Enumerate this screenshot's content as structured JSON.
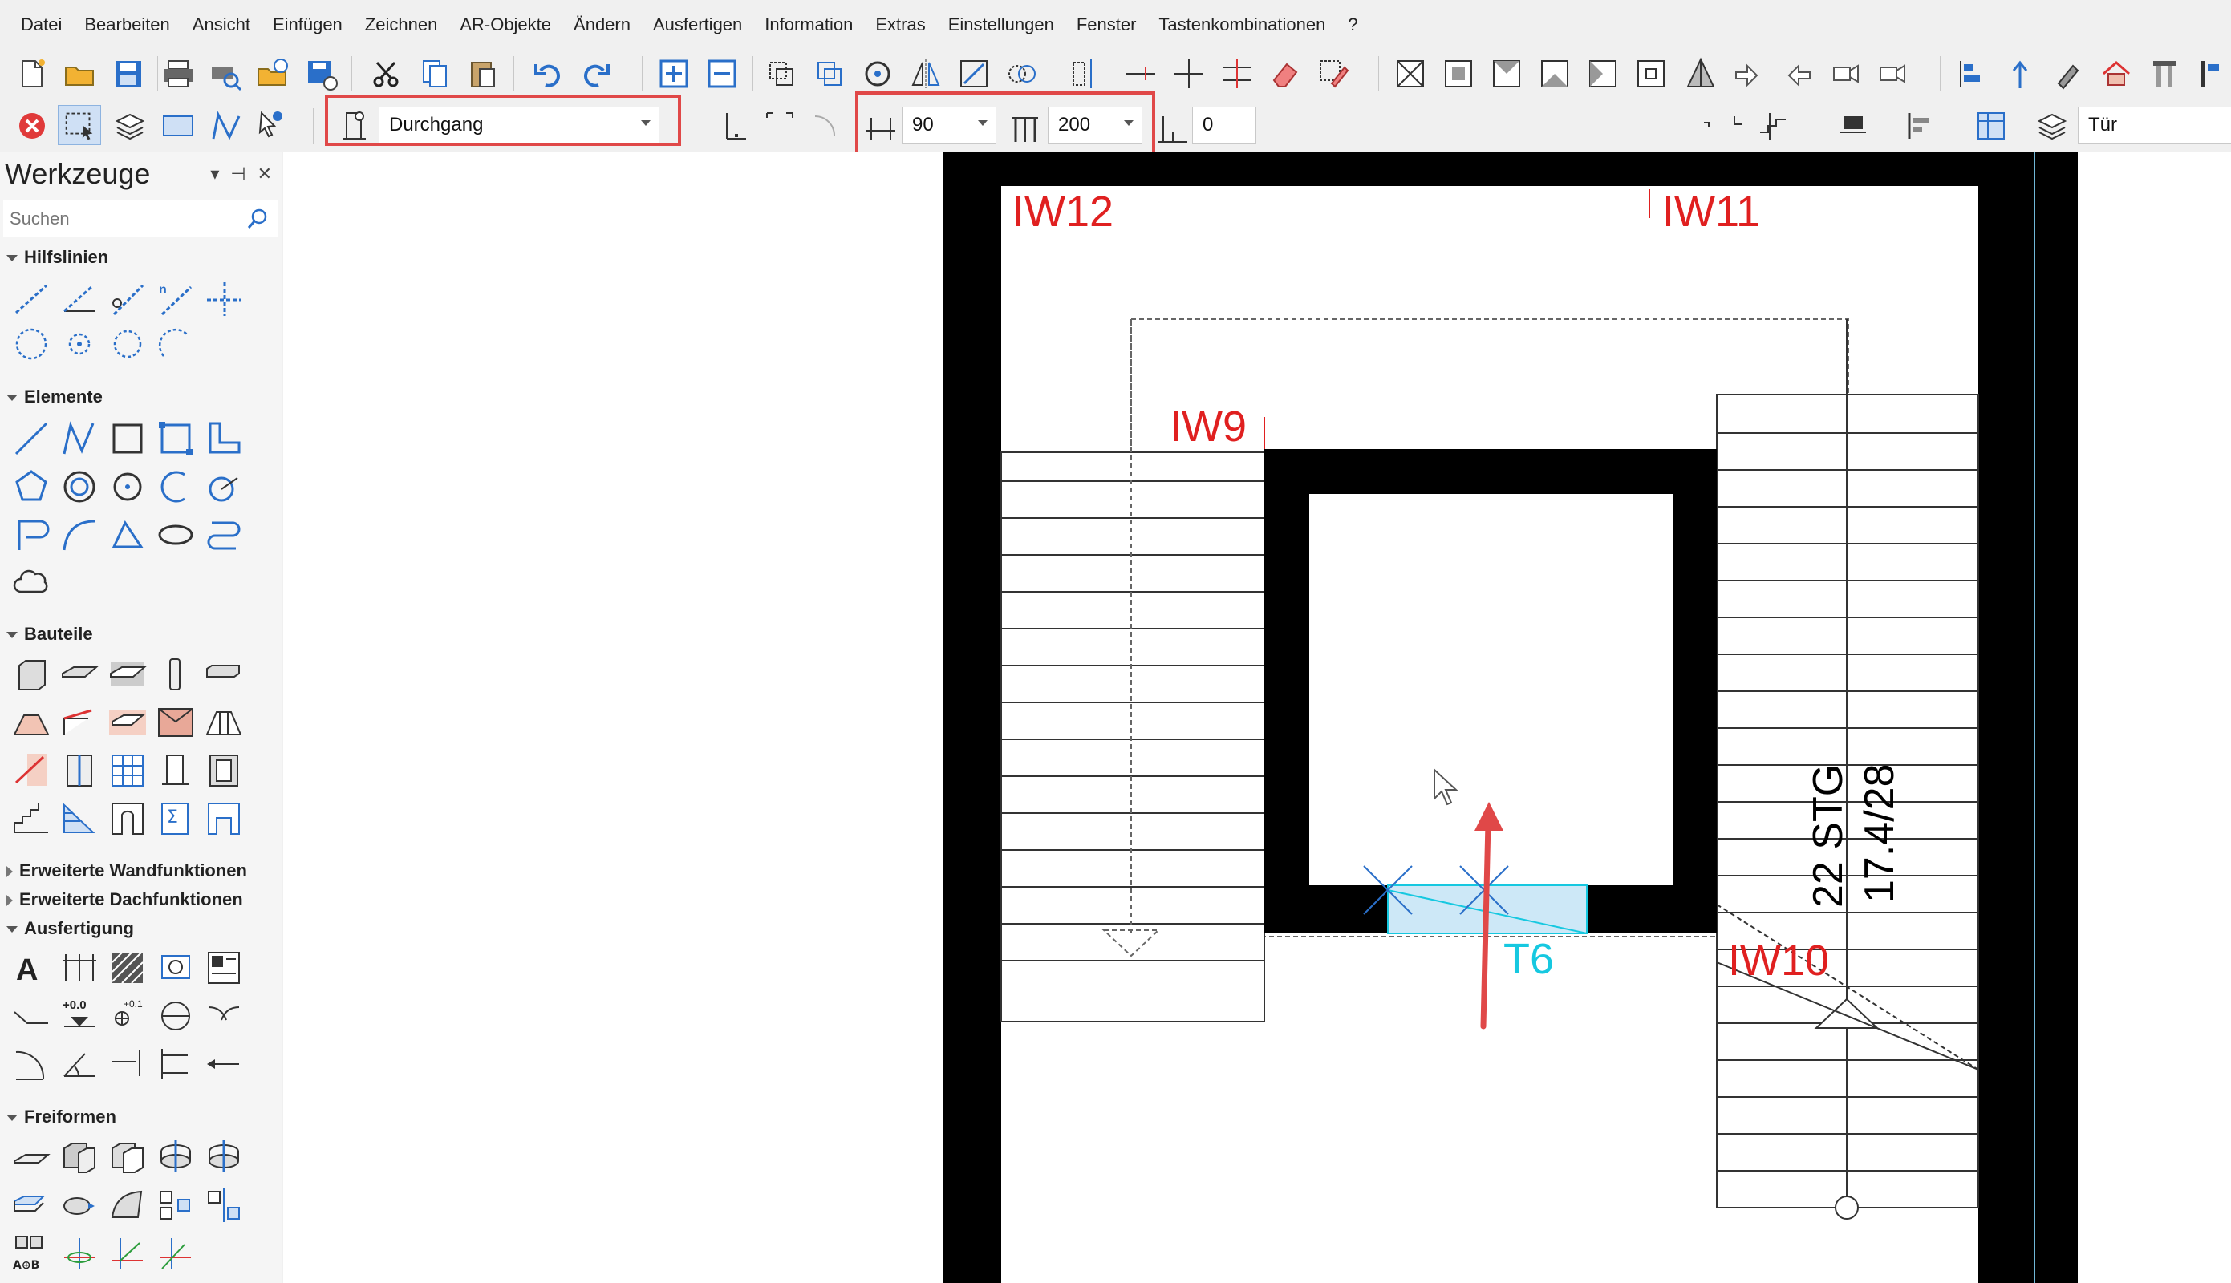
{
  "menu": [
    "Datei",
    "Bearbeiten",
    "Ansicht",
    "Einfügen",
    "Zeichnen",
    "AR-Objekte",
    "Ändern",
    "Ausfertigen",
    "Information",
    "Extras",
    "Einstellungen",
    "Fenster",
    "Tastenkombinationen",
    "?"
  ],
  "toolbar2": {
    "door_type": "Durchgang",
    "width_value": "90",
    "height_value": "200",
    "sill_value": "0",
    "layer_value": "Tür"
  },
  "panel": {
    "title": "Werkzeuge",
    "search_placeholder": "Suchen",
    "categories": {
      "hilfslinien": "Hilfslinien",
      "elemente": "Elemente",
      "bauteile": "Bauteile",
      "wand": "Erweiterte Wandfunktionen",
      "dach": "Erweiterte Dachfunktionen",
      "ausfertigung": "Ausfertigung",
      "freiformen": "Freiformen"
    },
    "label_plus00": "+0.0",
    "label_plus01": "+0.1",
    "label_aob": "A⊕B"
  },
  "drawing": {
    "labels": {
      "iw12": "IW12",
      "iw11": "IW11",
      "iw9": "IW9",
      "iw10": "IW10",
      "t6": "T6"
    },
    "stair_text": {
      "count": "22 STG",
      "ratio": "17.4/28"
    }
  },
  "colors": {
    "label_red": "#e02020",
    "door_cyan": "#16c8e0",
    "highlight_red": "#e04848",
    "door_fill": "#cde8f7"
  }
}
